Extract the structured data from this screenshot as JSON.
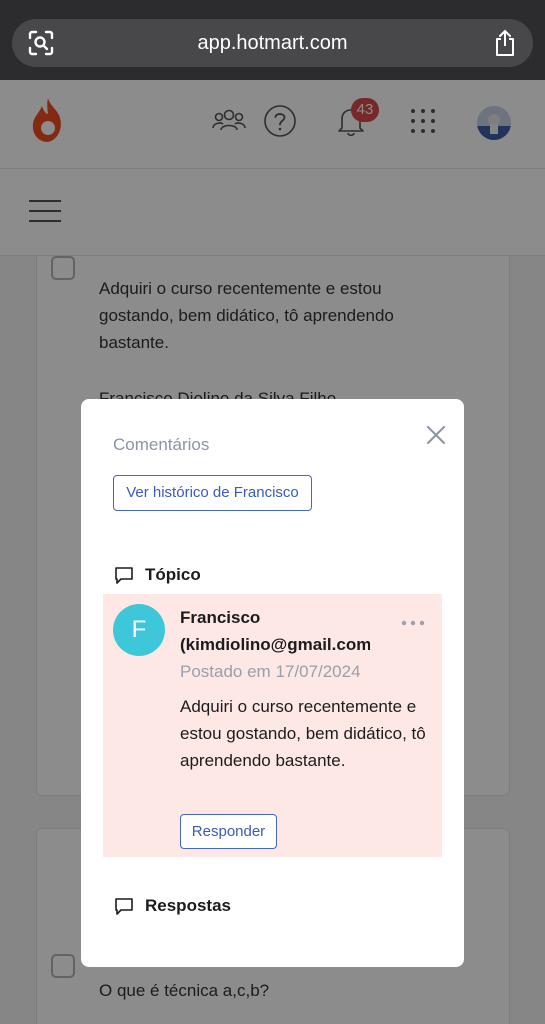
{
  "browser": {
    "url": "app.hotmart.com",
    "lens_icon": "visual-lookup-icon",
    "share_icon": "share-icon"
  },
  "header": {
    "logo": "hotmart-flame-logo",
    "icons": [
      "community-icon",
      "help-icon",
      "bell-icon",
      "apps-grid-icon"
    ],
    "notification_count": "43",
    "avatar": "user-avatar"
  },
  "subheader": {
    "menu_icon": "hamburger-menu-icon"
  },
  "background": {
    "post_text": "Adquiri o curso recentemente e estou gostando, bem didático, tô aprendendo bastante.",
    "author_line": "Francisco Diolino da Silva Filho",
    "question_text": "O que é técnica a,c,b?"
  },
  "modal": {
    "title": "Comentários",
    "history_button": "Ver histórico de Francisco",
    "topic_label": "Tópico",
    "author_initial": "F",
    "author_name": "Francisco",
    "author_email": "(kimdiolino@gmail.com",
    "post_date": "Postado em 17/07/2024",
    "post_body": "Adquiri o curso recentemente e estou gostando, bem didático, tô aprendendo bastante.",
    "reply_button": "Responder",
    "answers_label": "Respostas"
  },
  "colors": {
    "accent_blue": "#3a5cb8",
    "brand_orange": "#f04e23",
    "topic_bg": "#fde8e5",
    "avatar_cyan": "#3ec6d9",
    "badge_red": "#d94a4a"
  }
}
